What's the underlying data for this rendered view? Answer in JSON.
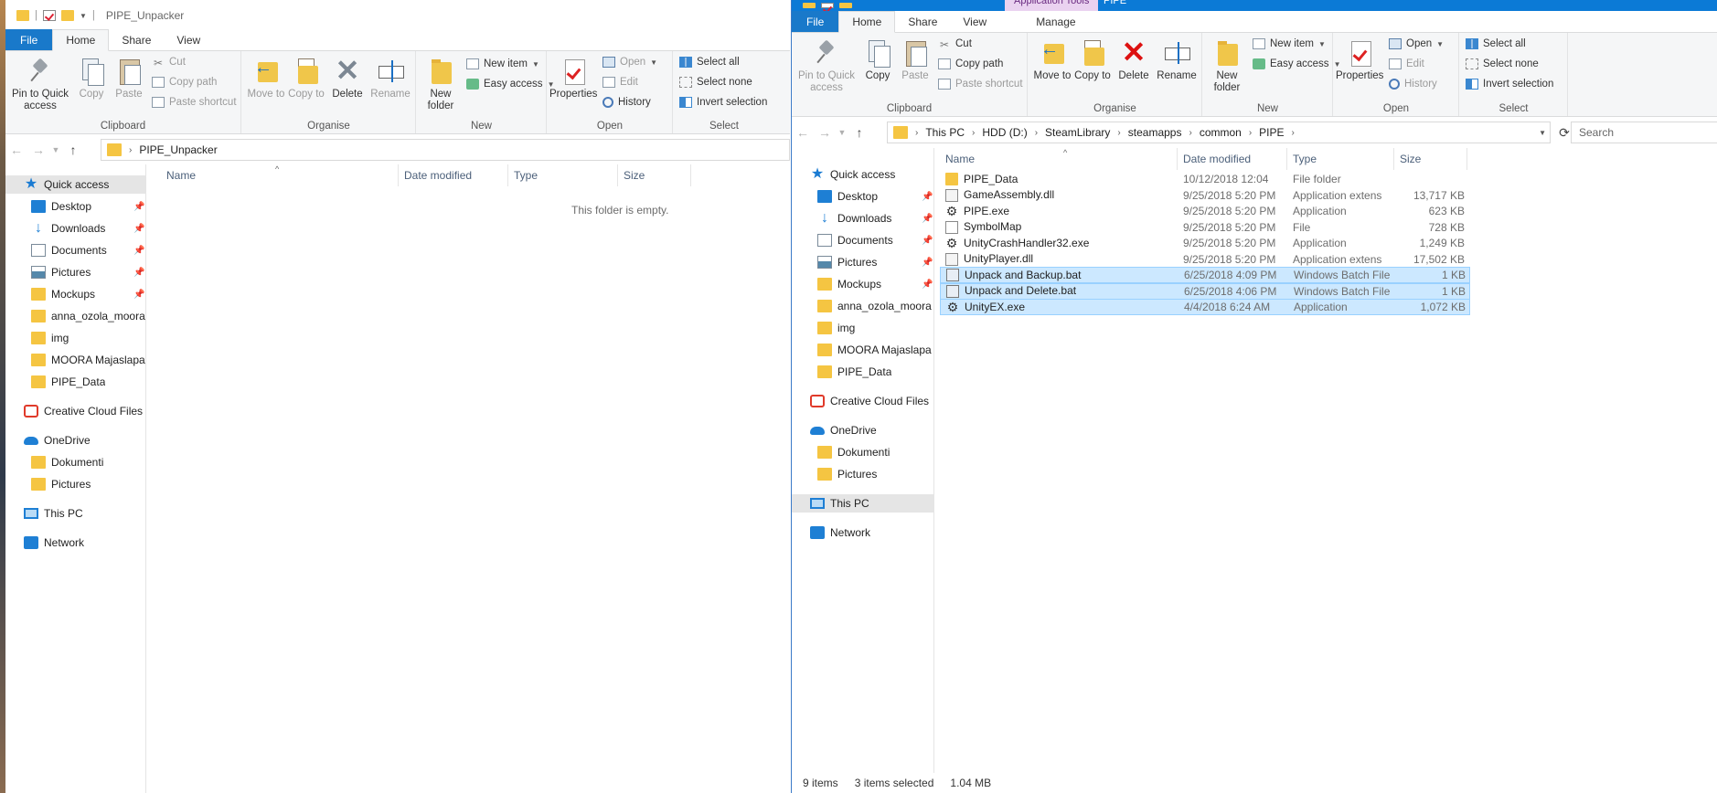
{
  "left": {
    "title": "PIPE_Unpacker",
    "tabs": [
      "File",
      "Home",
      "Share",
      "View"
    ],
    "ribbon": {
      "clipboard": {
        "label": "Clipboard",
        "pin": "Pin to Quick access",
        "copy": "Copy",
        "paste": "Paste",
        "cut": "Cut",
        "copy_path": "Copy path",
        "paste_shortcut": "Paste shortcut"
      },
      "organise": {
        "label": "Organise",
        "move_to": "Move to",
        "copy_to": "Copy to",
        "delete": "Delete",
        "rename": "Rename"
      },
      "new": {
        "label": "New",
        "new_folder": "New folder",
        "new_item": "New item",
        "easy_access": "Easy access"
      },
      "open": {
        "label": "Open",
        "properties": "Properties",
        "open": "Open",
        "edit": "Edit",
        "history": "History"
      },
      "select": {
        "label": "Select",
        "select_all": "Select all",
        "select_none": "Select none",
        "invert": "Invert selection"
      }
    },
    "address": {
      "path": [
        "PIPE_Unpacker"
      ]
    },
    "nav": {
      "quick_access": "Quick access",
      "items": [
        "Desktop",
        "Downloads",
        "Documents",
        "Pictures",
        "Mockups",
        "anna_ozola_moora",
        "img",
        "MOORA Majaslapa",
        "PIPE_Data"
      ],
      "creative_cloud": "Creative Cloud Files",
      "onedrive": "OneDrive",
      "onedrive_items": [
        "Dokumenti",
        "Pictures"
      ],
      "this_pc": "This PC",
      "network": "Network"
    },
    "columns": {
      "name": "Name",
      "date": "Date modified",
      "type": "Type",
      "size": "Size"
    },
    "empty_text": "This folder is empty."
  },
  "right": {
    "title": "PIPE",
    "context_tab": "Application Tools",
    "tabs": [
      "File",
      "Home",
      "Share",
      "View",
      "Manage"
    ],
    "ribbon": {
      "clipboard": {
        "label": "Clipboard",
        "pin": "Pin to Quick access",
        "copy": "Copy",
        "paste": "Paste",
        "cut": "Cut",
        "copy_path": "Copy path",
        "paste_shortcut": "Paste shortcut"
      },
      "organise": {
        "label": "Organise",
        "move_to": "Move to",
        "copy_to": "Copy to",
        "delete": "Delete",
        "rename": "Rename"
      },
      "new": {
        "label": "New",
        "new_folder": "New folder",
        "new_item": "New item",
        "easy_access": "Easy access"
      },
      "open": {
        "label": "Open",
        "properties": "Properties",
        "open": "Open",
        "edit": "Edit",
        "history": "History"
      },
      "select": {
        "label": "Select",
        "select_all": "Select all",
        "select_none": "Select none",
        "invert": "Invert selection"
      }
    },
    "address": {
      "path": [
        "This PC",
        "HDD (D:)",
        "SteamLibrary",
        "steamapps",
        "common",
        "PIPE"
      ],
      "search_placeholder": "Search"
    },
    "nav": {
      "quick_access": "Quick access",
      "items": [
        "Desktop",
        "Downloads",
        "Documents",
        "Pictures",
        "Mockups",
        "anna_ozola_moora",
        "img",
        "MOORA Majaslapa",
        "PIPE_Data"
      ],
      "creative_cloud": "Creative Cloud Files",
      "onedrive": "OneDrive",
      "onedrive_items": [
        "Dokumenti",
        "Pictures"
      ],
      "this_pc": "This PC",
      "network": "Network"
    },
    "columns": {
      "name": "Name",
      "date": "Date modified",
      "type": "Type",
      "size": "Size"
    },
    "files": [
      {
        "name": "PIPE_Data",
        "date": "10/12/2018 12:04",
        "type": "File folder",
        "size": "",
        "icon": "folder-icon",
        "selected": false
      },
      {
        "name": "GameAssembly.dll",
        "date": "9/25/2018 5:20 PM",
        "type": "Application extens",
        "size": "13,717 KB",
        "icon": "dll-icon",
        "selected": false
      },
      {
        "name": "PIPE.exe",
        "date": "9/25/2018 5:20 PM",
        "type": "Application",
        "size": "623 KB",
        "icon": "exe-icon",
        "selected": false
      },
      {
        "name": "SymbolMap",
        "date": "9/25/2018 5:20 PM",
        "type": "File",
        "size": "728 KB",
        "icon": "file-icon",
        "selected": false
      },
      {
        "name": "UnityCrashHandler32.exe",
        "date": "9/25/2018 5:20 PM",
        "type": "Application",
        "size": "1,249 KB",
        "icon": "exe-icon",
        "selected": false
      },
      {
        "name": "UnityPlayer.dll",
        "date": "9/25/2018 5:20 PM",
        "type": "Application extens",
        "size": "17,502 KB",
        "icon": "dll-icon",
        "selected": false
      },
      {
        "name": "Unpack and Backup.bat",
        "date": "6/25/2018 4:09 PM",
        "type": "Windows Batch File",
        "size": "1 KB",
        "icon": "bat-icon",
        "selected": true
      },
      {
        "name": "Unpack and Delete.bat",
        "date": "6/25/2018 4:06 PM",
        "type": "Windows Batch File",
        "size": "1 KB",
        "icon": "bat-icon",
        "selected": true
      },
      {
        "name": "UnityEX.exe",
        "date": "4/4/2018 6:24 AM",
        "type": "Application",
        "size": "1,072 KB",
        "icon": "exe-icon",
        "selected": true
      }
    ],
    "status": {
      "items": "9 items",
      "selected": "3 items selected",
      "size": "1.04 MB"
    }
  }
}
